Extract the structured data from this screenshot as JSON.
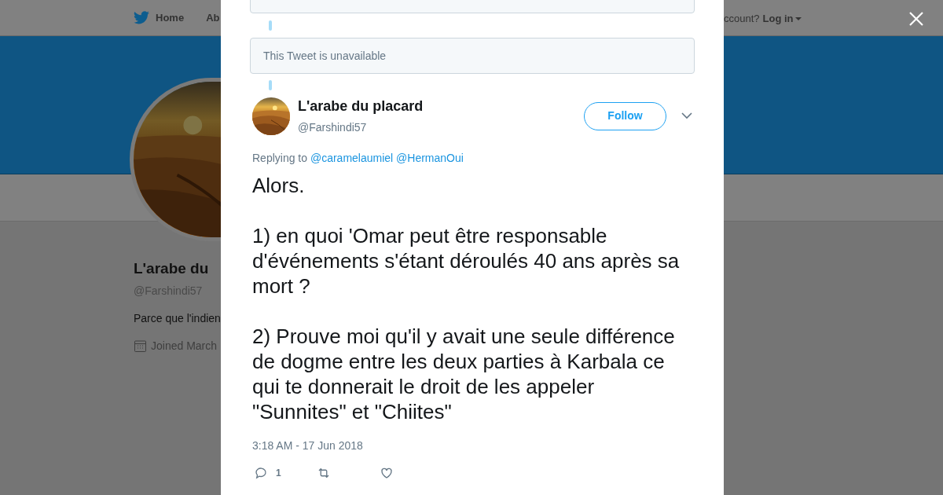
{
  "background_page": {
    "nav": {
      "items": [
        {
          "label": "Home",
          "kind": "home"
        },
        {
          "label": "Ab",
          "kind": "plain"
        }
      ],
      "account_prompt": "ccount?",
      "login": "Log in"
    },
    "profile": {
      "name": "L'arabe du",
      "handle": "@Farshindi57",
      "bio": "Parce que l'indien",
      "joined": "Joined March"
    }
  },
  "modal": {
    "thread": [
      {
        "kind": "cut_box"
      },
      {
        "kind": "unavailable",
        "text": "This Tweet is unavailable"
      }
    ],
    "tweet": {
      "author": {
        "name": "L'arabe du placard",
        "handle": "@Farshindi57"
      },
      "follow_button": "Follow",
      "reply_prefix": "Replying to",
      "reply_to": [
        "@caramelaumiel",
        "@HermanOui"
      ],
      "paragraphs": [
        "Alors.",
        "1) en quoi 'Omar peut être responsable d'événements s'étant déroulés 40 ans après sa mort ?",
        "2) Prouve moi qu'il y avait une seule différence de dogme entre les deux parties à Karbala ce qui te donnerait le droit de les appeler \"Sunnites\" et \"Chiites\""
      ],
      "timestamp": "3:18 AM - 17 Jun 2018",
      "actions": [
        {
          "kind": "reply",
          "count": "1"
        },
        {
          "kind": "retweet"
        },
        {
          "kind": "like"
        }
      ]
    }
  }
}
